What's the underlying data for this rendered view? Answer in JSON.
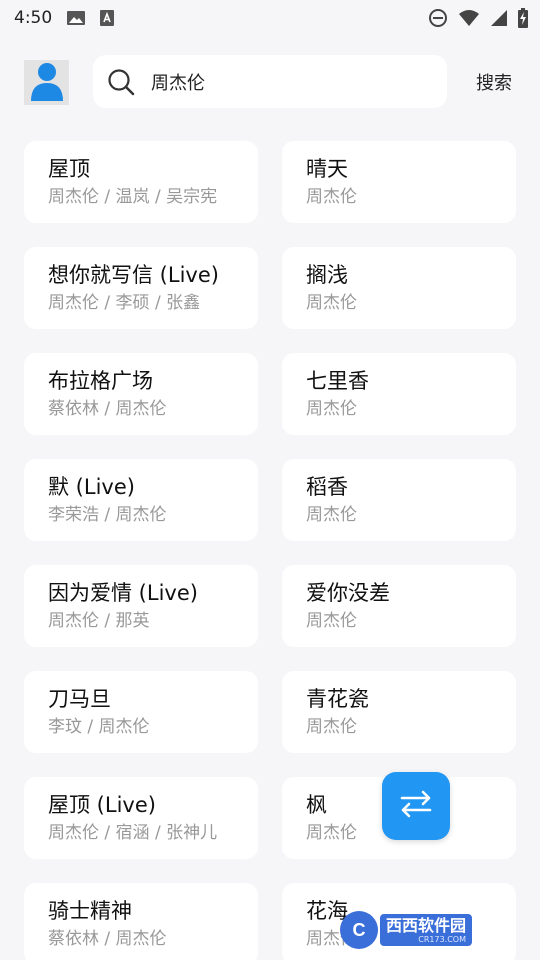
{
  "status_bar": {
    "time": "4:50",
    "icons": [
      "image-icon",
      "text-a-icon",
      "do-not-disturb-icon",
      "wifi-icon",
      "signal-icon",
      "battery-charging-icon"
    ]
  },
  "header": {
    "avatar_icon": "user-icon",
    "search": {
      "icon": "search-icon",
      "value": "周杰伦"
    },
    "search_button_label": "搜索"
  },
  "songs": [
    {
      "title": "屋顶",
      "artist": "周杰伦 / 温岚 / 吴宗宪"
    },
    {
      "title": "晴天",
      "artist": "周杰伦"
    },
    {
      "title": "想你就写信 (Live)",
      "artist": "周杰伦 / 李硕 / 张鑫"
    },
    {
      "title": "搁浅",
      "artist": "周杰伦"
    },
    {
      "title": "布拉格广场",
      "artist": "蔡依林 / 周杰伦"
    },
    {
      "title": "七里香",
      "artist": "周杰伦"
    },
    {
      "title": "默 (Live)",
      "artist": "李荣浩 / 周杰伦"
    },
    {
      "title": "稻香",
      "artist": "周杰伦"
    },
    {
      "title": "因为爱情 (Live)",
      "artist": "周杰伦 / 那英"
    },
    {
      "title": "爱你没差",
      "artist": "周杰伦"
    },
    {
      "title": "刀马旦",
      "artist": "李玟 / 周杰伦"
    },
    {
      "title": "青花瓷",
      "artist": "周杰伦"
    },
    {
      "title": "屋顶 (Live)",
      "artist": "周杰伦 / 宿涵 / 张神儿"
    },
    {
      "title": "枫",
      "artist": "周杰伦"
    },
    {
      "title": "骑士精神",
      "artist": "蔡依林 / 周杰伦"
    },
    {
      "title": "花海",
      "artist": "周杰伦"
    }
  ],
  "fab": {
    "icon": "swap-arrows-icon"
  },
  "watermark": {
    "text": "西西软件园",
    "url": "CR173.COM"
  },
  "colors": {
    "accent": "#2196f3",
    "background": "#f6f6f8",
    "card": "#ffffff",
    "subtext": "#999999"
  }
}
